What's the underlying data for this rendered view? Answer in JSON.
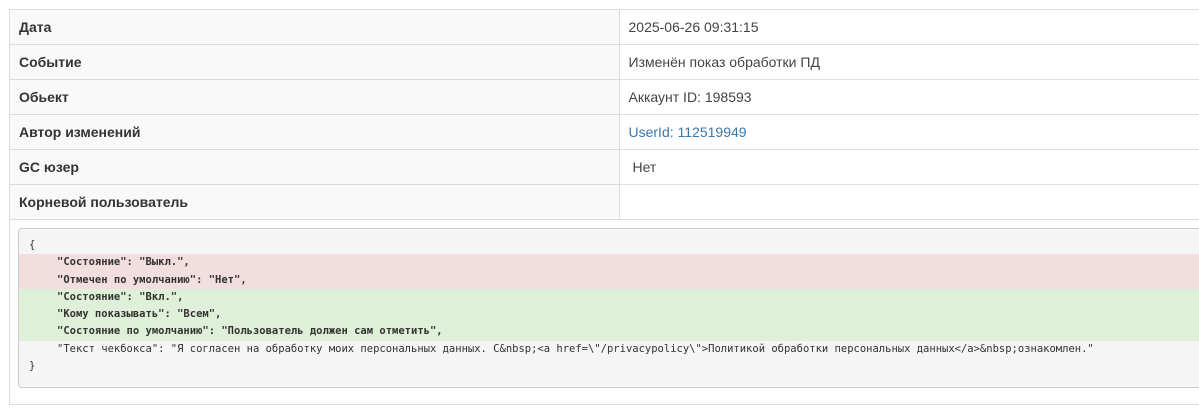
{
  "rows": [
    {
      "label": "Дата",
      "value": "2025-06-26 09:31:15"
    },
    {
      "label": "Событие",
      "value": "Изменён показ обработки ПД"
    },
    {
      "label": "Обьект",
      "value": "Аккаунт ID: 198593"
    },
    {
      "label": "Автор изменений",
      "value": "UserId: 112519949"
    },
    {
      "label": "GC юзер",
      "value": "Нет"
    },
    {
      "label": "Корневой пользователь",
      "value": ""
    }
  ],
  "diff": {
    "open_brace": "{",
    "close_brace": "}",
    "lines": [
      {
        "status": "removed",
        "text": "\"Состояние\": \"Выкл.\","
      },
      {
        "status": "removed",
        "text": "\"Отмечен по умолчанию\": \"Нет\","
      },
      {
        "status": "added",
        "text": "\"Состояние\": \"Вкл.\","
      },
      {
        "status": "added",
        "text": "\"Кому показывать\": \"Всем\","
      },
      {
        "status": "added",
        "text": "\"Состояние по умолчанию\": \"Пользователь должен сам отметить\","
      },
      {
        "status": "unchanged",
        "text": "\"Текст чекбокса\": \"Я согласен на обработку моих персональных данных. С&nbsp;<a href=\\\"/privacypolicy\\\">Политикой обработки персональных данных</a>&nbsp;ознакомлен.\""
      }
    ]
  },
  "colors": {
    "removed_bg": "#f2dede",
    "added_bg": "#dff0d8",
    "link": "#3a78b0"
  }
}
